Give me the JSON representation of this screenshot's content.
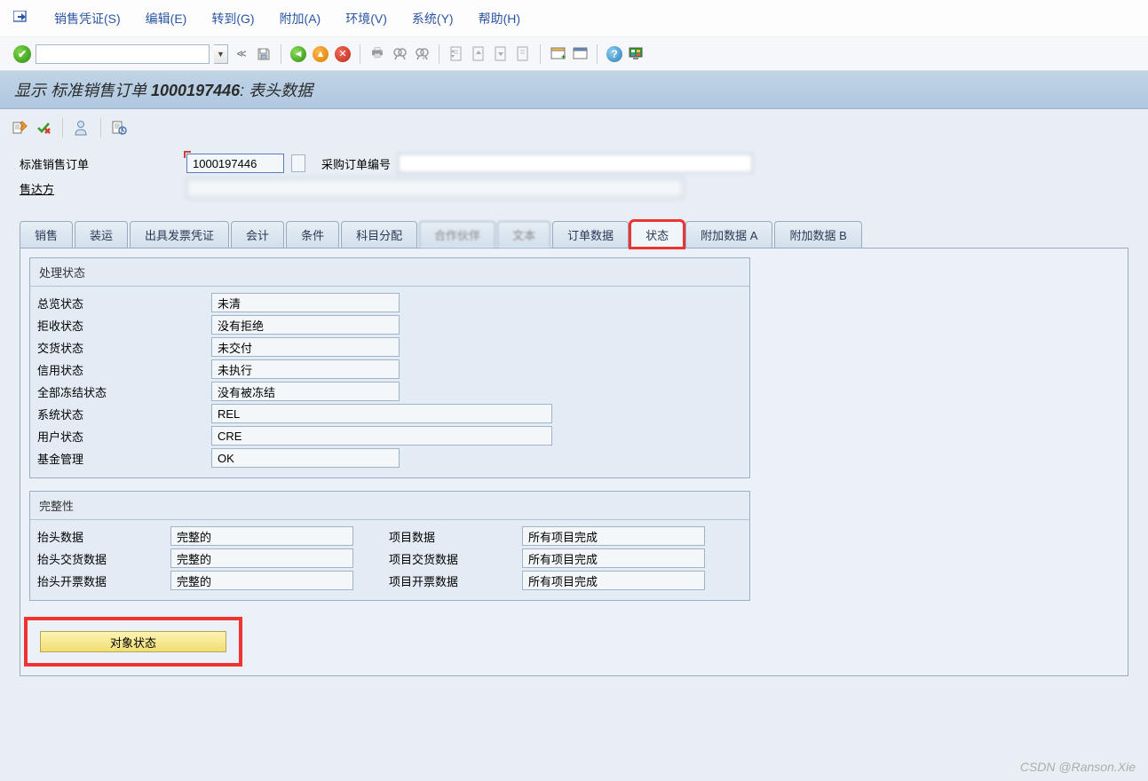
{
  "menu": {
    "items": [
      "销售凭证(S)",
      "编辑(E)",
      "转到(G)",
      "附加(A)",
      "环境(V)",
      "系统(Y)",
      "帮助(H)"
    ]
  },
  "toolbar": {
    "command_value": "",
    "icons": [
      "double-left",
      "save",
      "sep",
      "green-back",
      "orange-up",
      "red-cancel",
      "sep",
      "print",
      "find",
      "find-next",
      "sep",
      "first",
      "prev",
      "next",
      "last",
      "sep",
      "new-win",
      "shortcut",
      "sep",
      "help",
      "layout"
    ]
  },
  "title": {
    "prefix": "显示 标准销售订单 ",
    "number": "1000197446",
    "suffix": ": 表头数据"
  },
  "header_fields": {
    "order_label": "标准销售订单",
    "order_value": "1000197446",
    "po_label": "采购订单编号",
    "po_value": "",
    "soldto_label": "售达方",
    "soldto_value": ""
  },
  "tabs": [
    "销售",
    "装运",
    "出具发票凭证",
    "会计",
    "条件",
    "科目分配",
    "合作伙伴",
    "文本",
    "订单数据",
    "状态",
    "附加数据 A",
    "附加数据 B"
  ],
  "active_tab": 9,
  "group1": {
    "title": "处理状态",
    "rows": [
      {
        "label": "总览状态",
        "value": "未清"
      },
      {
        "label": "拒收状态",
        "value": "没有拒绝"
      },
      {
        "label": "交货状态",
        "value": "未交付"
      },
      {
        "label": "信用状态",
        "value": "未执行"
      },
      {
        "label": "全部冻结状态",
        "value": "没有被冻结"
      },
      {
        "label": "系统状态",
        "value": "REL",
        "wide": true
      },
      {
        "label": "用户状态",
        "value": "CRE",
        "wide": true
      },
      {
        "label": "基金管理",
        "value": "OK"
      }
    ]
  },
  "group2": {
    "title": "完整性",
    "left": [
      {
        "label": "抬头数据",
        "value": "完整的"
      },
      {
        "label": "抬头交货数据",
        "value": "完整的"
      },
      {
        "label": "抬头开票数据",
        "value": "完整的"
      }
    ],
    "right": [
      {
        "label": "项目数据",
        "value": "所有项目完成"
      },
      {
        "label": "项目交货数据",
        "value": "所有项目完成"
      },
      {
        "label": "项目开票数据",
        "value": "所有项目完成"
      }
    ]
  },
  "object_status_btn": "对象状态",
  "watermark": "CSDN @Ranson.Xie"
}
